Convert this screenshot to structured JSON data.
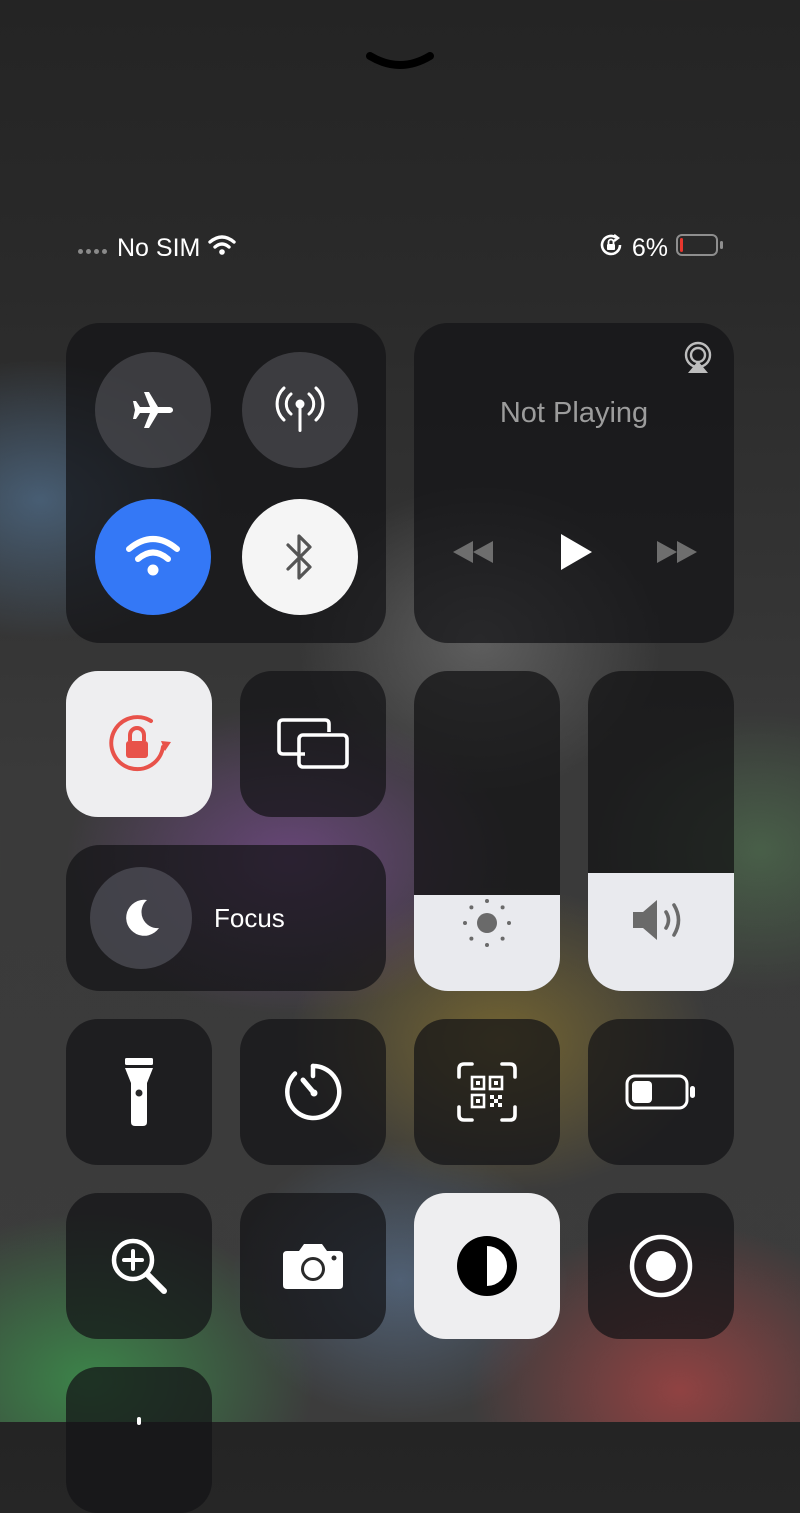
{
  "status_bar": {
    "carrier": "No SIM",
    "battery_percent": "6%",
    "battery_level": 0.06
  },
  "media": {
    "title": "Not Playing"
  },
  "focus": {
    "label": "Focus"
  },
  "sliders": {
    "brightness_level": 0.3,
    "volume_level": 0.37
  },
  "colors": {
    "wifi_active": "#3478f6",
    "orientation_lock": "#e8524a",
    "battery_low": "#e8372e"
  },
  "icons": {
    "airplane": "airplane-icon",
    "cellular": "cellular-antenna-icon",
    "wifi": "wifi-icon",
    "bluetooth": "bluetooth-icon",
    "airplay": "airplay-icon",
    "orientation_lock": "orientation-lock-icon",
    "screen_mirroring": "screen-mirroring-icon",
    "moon": "moon-icon",
    "brightness": "sun-icon",
    "volume": "speaker-icon",
    "flashlight": "flashlight-icon",
    "timer": "timer-icon",
    "qr": "qr-code-icon",
    "low_power": "battery-icon",
    "magnifier": "magnifier-icon",
    "camera": "camera-icon",
    "dark_mode": "dark-mode-icon",
    "screen_record": "record-icon"
  }
}
